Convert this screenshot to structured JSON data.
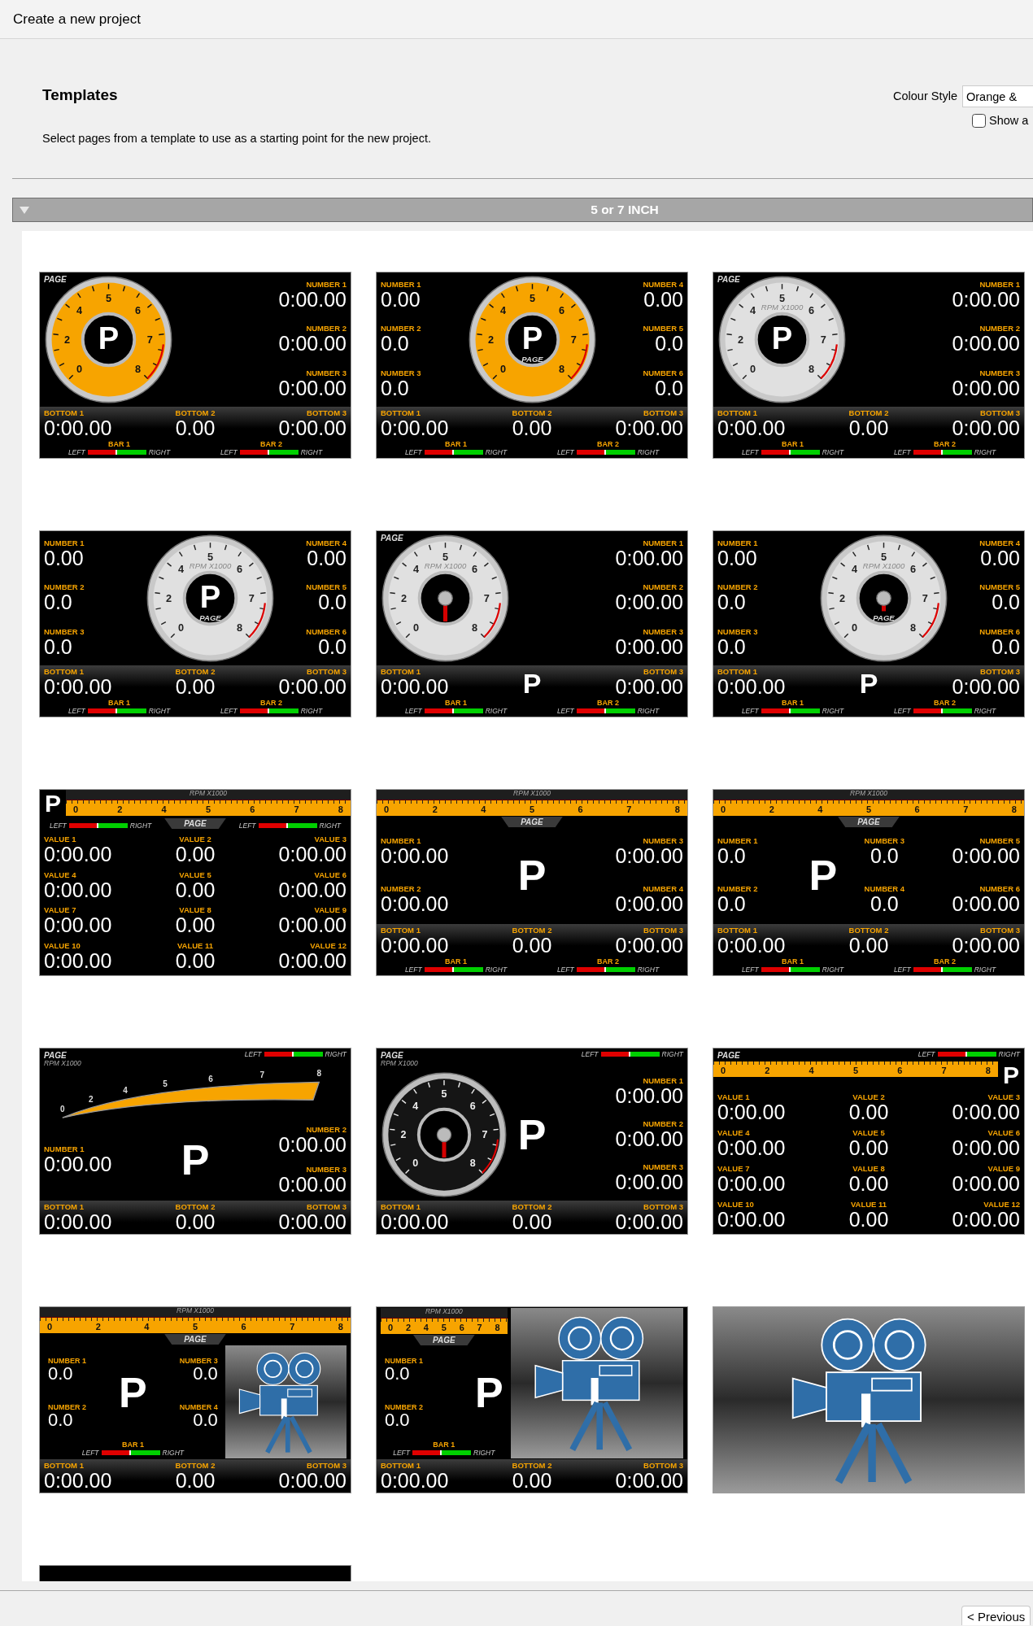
{
  "window": {
    "title": "Create a new project"
  },
  "header": {
    "title": "Templates",
    "description": "Select pages from a template to use as a starting point for the new project."
  },
  "colour_style": {
    "label": "Colour Style",
    "value": "Orange &"
  },
  "show_option": {
    "label": "Show a",
    "checked": false
  },
  "group": {
    "title": "5 or 7 INCH",
    "expanded": true,
    "templates": [
      {
        "kind": "preview",
        "sections": [
          {
            "kind": "main",
            "page": "PAGE",
            "columns": [
              [
                {
                  "kind": "dial",
                  "ticks": [
                    "0",
                    "2",
                    "4",
                    "5",
                    "6",
                    "7",
                    "8"
                  ],
                  "gear": "P",
                  "needle": false
                }
              ],
              [
                {
                  "kind": "number",
                  "label": "NUMBER 1",
                  "value": "0:00.00"
                },
                {
                  "kind": "number",
                  "label": "NUMBER 2",
                  "value": "0:00.00"
                },
                {
                  "kind": "number",
                  "label": "NUMBER 3",
                  "value": "0:00.00"
                }
              ]
            ]
          },
          {
            "kind": "bottom",
            "items": [
              {
                "kind": "number",
                "label": "BOTTOM 1",
                "value": "0:00.00"
              },
              {
                "kind": "number",
                "label": "BOTTOM 2",
                "value": "0.00"
              },
              {
                "kind": "number",
                "label": "BOTTOM 3",
                "value": "0:00.00"
              }
            ]
          },
          {
            "kind": "bars",
            "bars": [
              {
                "label": "BAR 1",
                "left": "LEFT",
                "right": "RIGHT",
                "level": 0.5
              },
              {
                "label": "BAR 2",
                "left": "LEFT",
                "right": "RIGHT",
                "level": 0.5
              }
            ]
          }
        ]
      },
      {
        "kind": "preview",
        "sections": [
          {
            "kind": "main",
            "columns": [
              [
                {
                  "kind": "number",
                  "label": "NUMBER 1",
                  "value": "0.00"
                },
                {
                  "kind": "number",
                  "label": "NUMBER 2",
                  "value": "0.0"
                },
                {
                  "kind": "number",
                  "label": "NUMBER 3",
                  "value": "0.0"
                }
              ],
              [
                {
                  "kind": "dial",
                  "ticks": [
                    "0",
                    "2",
                    "4",
                    "5",
                    "6",
                    "7",
                    "8"
                  ],
                  "gear": "P",
                  "page": "PAGE",
                  "needle": false
                }
              ],
              [
                {
                  "kind": "number",
                  "label": "NUMBER 4",
                  "value": "0.00"
                },
                {
                  "kind": "number",
                  "label": "NUMBER 5",
                  "value": "0.0"
                },
                {
                  "kind": "number",
                  "label": "NUMBER 6",
                  "value": "0.0"
                }
              ]
            ]
          },
          {
            "kind": "bottom",
            "items": [
              {
                "kind": "number",
                "label": "BOTTOM 1",
                "value": "0:00.00"
              },
              {
                "kind": "number",
                "label": "BOTTOM 2",
                "value": "0.00"
              },
              {
                "kind": "number",
                "label": "BOTTOM 3",
                "value": "0:00.00"
              }
            ]
          },
          {
            "kind": "bars",
            "bars": [
              {
                "label": "BAR 1",
                "left": "LEFT",
                "right": "RIGHT",
                "level": 0.5
              },
              {
                "label": "BAR 2",
                "left": "LEFT",
                "right": "RIGHT",
                "level": 0.5
              }
            ]
          }
        ]
      },
      {
        "kind": "preview",
        "sections": [
          {
            "kind": "main",
            "page": "PAGE",
            "columns": [
              [
                {
                  "kind": "silverdial",
                  "ticks": [
                    "0",
                    "2",
                    "4",
                    "5",
                    "6",
                    "7",
                    "8"
                  ],
                  "scale": "RPM X1000",
                  "gear": "P",
                  "needle": false
                }
              ],
              [
                {
                  "kind": "number",
                  "label": "NUMBER 1",
                  "value": "0:00.00"
                },
                {
                  "kind": "number",
                  "label": "NUMBER 2",
                  "value": "0:00.00"
                },
                {
                  "kind": "number",
                  "label": "NUMBER 3",
                  "value": "0:00.00"
                }
              ]
            ]
          },
          {
            "kind": "bottom",
            "items": [
              {
                "kind": "number",
                "label": "BOTTOM 1",
                "value": "0:00.00"
              },
              {
                "kind": "number",
                "label": "BOTTOM 2",
                "value": "0.00"
              },
              {
                "kind": "number",
                "label": "BOTTOM 3",
                "value": "0:00.00"
              }
            ]
          },
          {
            "kind": "bars",
            "bars": [
              {
                "label": "BAR 1",
                "left": "LEFT",
                "right": "RIGHT",
                "level": 0.5
              },
              {
                "label": "BAR 2",
                "left": "LEFT",
                "right": "RIGHT",
                "level": 0.5
              }
            ]
          }
        ]
      },
      {
        "kind": "preview",
        "sections": [
          {
            "kind": "main",
            "columns": [
              [
                {
                  "kind": "number",
                  "label": "NUMBER 1",
                  "value": "0.00"
                },
                {
                  "kind": "number",
                  "label": "NUMBER 2",
                  "value": "0.0"
                },
                {
                  "kind": "number",
                  "label": "NUMBER 3",
                  "value": "0.0"
                }
              ],
              [
                {
                  "kind": "silverdial",
                  "ticks": [
                    "0",
                    "2",
                    "4",
                    "5",
                    "6",
                    "7",
                    "8"
                  ],
                  "scale": "RPM X1000",
                  "gear": "P",
                  "page": "PAGE",
                  "needle": false
                }
              ],
              [
                {
                  "kind": "number",
                  "label": "NUMBER 4",
                  "value": "0.00"
                },
                {
                  "kind": "number",
                  "label": "NUMBER 5",
                  "value": "0.0"
                },
                {
                  "kind": "number",
                  "label": "NUMBER 6",
                  "value": "0.0"
                }
              ]
            ]
          },
          {
            "kind": "bottom",
            "items": [
              {
                "kind": "number",
                "label": "BOTTOM 1",
                "value": "0:00.00"
              },
              {
                "kind": "number",
                "label": "BOTTOM 2",
                "value": "0.00"
              },
              {
                "kind": "number",
                "label": "BOTTOM 3",
                "value": "0:00.00"
              }
            ]
          },
          {
            "kind": "bars",
            "bars": [
              {
                "label": "BAR 1",
                "left": "LEFT",
                "right": "RIGHT",
                "level": 0.5
              },
              {
                "label": "BAR 2",
                "left": "LEFT",
                "right": "RIGHT",
                "level": 0.5
              }
            ]
          }
        ]
      },
      {
        "kind": "preview",
        "sections": [
          {
            "kind": "main",
            "page": "PAGE",
            "columns": [
              [
                {
                  "kind": "silverdial",
                  "ticks": [
                    "0",
                    "2",
                    "4",
                    "5",
                    "6",
                    "7",
                    "8"
                  ],
                  "scale": "RPM X1000",
                  "needle": true
                }
              ],
              [
                {
                  "kind": "number",
                  "label": "NUMBER 1",
                  "value": "0:00.00"
                },
                {
                  "kind": "number",
                  "label": "NUMBER 2",
                  "value": "0:00.00"
                },
                {
                  "kind": "number",
                  "label": "NUMBER 3",
                  "value": "0:00.00"
                }
              ]
            ]
          },
          {
            "kind": "bottom",
            "items": [
              {
                "kind": "number",
                "label": "BOTTOM 1",
                "value": "0:00.00"
              },
              {
                "kind": "gear",
                "text": "P"
              },
              {
                "kind": "number",
                "label": "BOTTOM 3",
                "value": "0:00.00"
              }
            ]
          },
          {
            "kind": "bars",
            "bars": [
              {
                "label": "BAR 1",
                "left": "LEFT",
                "right": "RIGHT",
                "level": 0.5
              },
              {
                "label": "BAR 2",
                "left": "LEFT",
                "right": "RIGHT",
                "level": 0.5
              }
            ]
          }
        ]
      },
      {
        "kind": "preview",
        "sections": [
          {
            "kind": "main",
            "columns": [
              [
                {
                  "kind": "number",
                  "label": "NUMBER 1",
                  "value": "0.00"
                },
                {
                  "kind": "number",
                  "label": "NUMBER 2",
                  "value": "0.0"
                },
                {
                  "kind": "number",
                  "label": "NUMBER 3",
                  "value": "0.0"
                }
              ],
              [
                {
                  "kind": "silverdial",
                  "ticks": [
                    "0",
                    "2",
                    "4",
                    "5",
                    "6",
                    "7",
                    "8"
                  ],
                  "scale": "RPM X1000",
                  "page": "PAGE",
                  "needle": true
                }
              ],
              [
                {
                  "kind": "number",
                  "label": "NUMBER 4",
                  "value": "0.00"
                },
                {
                  "kind": "number",
                  "label": "NUMBER 5",
                  "value": "0.0"
                },
                {
                  "kind": "number",
                  "label": "NUMBER 6",
                  "value": "0.0"
                }
              ]
            ]
          },
          {
            "kind": "bottom",
            "items": [
              {
                "kind": "number",
                "label": "BOTTOM 1",
                "value": "0:00.00"
              },
              {
                "kind": "gear",
                "text": "P"
              },
              {
                "kind": "number",
                "label": "BOTTOM 3",
                "value": "0:00.00"
              }
            ]
          },
          {
            "kind": "bars",
            "bars": [
              {
                "label": "BAR 1",
                "left": "LEFT",
                "right": "RIGHT",
                "level": 0.5
              },
              {
                "label": "BAR 2",
                "left": "LEFT",
                "right": "RIGHT",
                "level": 0.5
              }
            ]
          }
        ]
      },
      {
        "kind": "preview",
        "sections": [
          {
            "kind": "ruler",
            "scale": "RPM X1000",
            "ticks": [
              "0",
              "2",
              "4",
              "5",
              "6",
              "7",
              "8"
            ],
            "gear": "P"
          },
          {
            "kind": "bars",
            "page": "PAGE",
            "bars": [
              {
                "left": "LEFT",
                "right": "RIGHT",
                "level": 0.5
              },
              {
                "left": "LEFT",
                "right": "RIGHT",
                "level": 0.5
              }
            ]
          },
          {
            "kind": "main",
            "columns": [
              [
                {
                  "kind": "number",
                  "label": "VALUE 1",
                  "value": "0:00.00"
                },
                {
                  "kind": "number",
                  "label": "VALUE 4",
                  "value": "0:00.00"
                },
                {
                  "kind": "number",
                  "label": "VALUE 7",
                  "value": "0:00.00"
                },
                {
                  "kind": "number",
                  "label": "VALUE 10",
                  "value": "0:00.00"
                }
              ],
              [
                {
                  "kind": "number",
                  "label": "VALUE 2",
                  "value": "0.00"
                },
                {
                  "kind": "number",
                  "label": "VALUE 5",
                  "value": "0.00"
                },
                {
                  "kind": "number",
                  "label": "VALUE 8",
                  "value": "0.00"
                },
                {
                  "kind": "number",
                  "label": "VALUE 11",
                  "value": "0.00"
                }
              ],
              [
                {
                  "kind": "number",
                  "label": "VALUE 3",
                  "value": "0:00.00"
                },
                {
                  "kind": "number",
                  "label": "VALUE 6",
                  "value": "0:00.00"
                },
                {
                  "kind": "number",
                  "label": "VALUE 9",
                  "value": "0:00.00"
                },
                {
                  "kind": "number",
                  "label": "VALUE 12",
                  "value": "0:00.00"
                }
              ]
            ]
          }
        ]
      },
      {
        "kind": "preview",
        "sections": [
          {
            "kind": "ruler",
            "scale": "RPM X1000",
            "ticks": [
              "0",
              "2",
              "4",
              "5",
              "6",
              "7",
              "8"
            ]
          },
          {
            "kind": "tab",
            "page": "PAGE"
          },
          {
            "kind": "main",
            "columns": [
              [
                {
                  "kind": "number",
                  "label": "NUMBER 1",
                  "value": "0:00.00"
                },
                {
                  "kind": "number",
                  "label": "NUMBER 2",
                  "value": "0:00.00"
                }
              ],
              [
                {
                  "kind": "gear",
                  "text": "P"
                }
              ],
              [
                {
                  "kind": "number",
                  "label": "NUMBER 3",
                  "value": "0:00.00"
                },
                {
                  "kind": "number",
                  "label": "NUMBER 4",
                  "value": "0:00.00"
                }
              ]
            ]
          },
          {
            "kind": "bottom",
            "items": [
              {
                "kind": "number",
                "label": "BOTTOM 1",
                "value": "0:00.00"
              },
              {
                "kind": "number",
                "label": "BOTTOM 2",
                "value": "0.00"
              },
              {
                "kind": "number",
                "label": "BOTTOM 3",
                "value": "0:00.00"
              }
            ]
          },
          {
            "kind": "bars",
            "bars": [
              {
                "label": "BAR 1",
                "left": "LEFT",
                "right": "RIGHT",
                "level": 0.5
              },
              {
                "label": "BAR 2",
                "left": "LEFT",
                "right": "RIGHT",
                "level": 0.5
              }
            ]
          }
        ]
      },
      {
        "kind": "preview",
        "sections": [
          {
            "kind": "ruler",
            "scale": "RPM X1000",
            "ticks": [
              "0",
              "2",
              "4",
              "5",
              "6",
              "7",
              "8"
            ]
          },
          {
            "kind": "tab",
            "page": "PAGE"
          },
          {
            "kind": "main",
            "columns": [
              [
                {
                  "kind": "number",
                  "label": "NUMBER 1",
                  "value": "0.0"
                },
                {
                  "kind": "number",
                  "label": "NUMBER 2",
                  "value": "0.0"
                }
              ],
              [
                {
                  "kind": "gear",
                  "text": "P"
                }
              ],
              [
                {
                  "kind": "number",
                  "label": "NUMBER 3",
                  "value": "0.0"
                },
                {
                  "kind": "number",
                  "label": "NUMBER 4",
                  "value": "0.0"
                }
              ],
              [
                {
                  "kind": "number",
                  "label": "NUMBER 5",
                  "value": "0:00.00"
                },
                {
                  "kind": "number",
                  "label": "NUMBER 6",
                  "value": "0:00.00"
                }
              ]
            ]
          },
          {
            "kind": "bottom",
            "items": [
              {
                "kind": "number",
                "label": "BOTTOM 1",
                "value": "0:00.00"
              },
              {
                "kind": "number",
                "label": "BOTTOM 2",
                "value": "0.00"
              },
              {
                "kind": "number",
                "label": "BOTTOM 3",
                "value": "0:00.00"
              }
            ]
          },
          {
            "kind": "bars",
            "bars": [
              {
                "label": "BAR 1",
                "left": "LEFT",
                "right": "RIGHT",
                "level": 0.5
              },
              {
                "label": "BAR 2",
                "left": "LEFT",
                "right": "RIGHT",
                "level": 0.5
              }
            ]
          }
        ]
      },
      {
        "kind": "preview",
        "sections": [
          {
            "kind": "header",
            "page": "PAGE",
            "scale": "RPM X1000",
            "bars": [
              {
                "left": "LEFT",
                "right": "RIGHT",
                "level": 0.5
              }
            ]
          },
          {
            "kind": "arc",
            "ticks": [
              "0",
              "2",
              "4",
              "5",
              "6",
              "7",
              "8"
            ]
          },
          {
            "kind": "main",
            "columns": [
              [
                {
                  "kind": "number",
                  "label": "NUMBER 1",
                  "value": "0:00.00"
                }
              ],
              [
                {
                  "kind": "gear",
                  "text": "P"
                }
              ],
              [
                {
                  "kind": "number",
                  "label": "NUMBER 2",
                  "value": "0:00.00"
                },
                {
                  "kind": "number",
                  "label": "NUMBER 3",
                  "value": "0:00.00"
                }
              ]
            ]
          },
          {
            "kind": "bottom",
            "items": [
              {
                "kind": "number",
                "label": "BOTTOM 1",
                "value": "0:00.00"
              },
              {
                "kind": "number",
                "label": "BOTTOM 2",
                "value": "0.00"
              },
              {
                "kind": "number",
                "label": "BOTTOM 3",
                "value": "0:00.00"
              }
            ]
          }
        ]
      },
      {
        "kind": "preview",
        "sections": [
          {
            "kind": "header",
            "page": "PAGE",
            "scale": "RPM X1000",
            "bars": [
              {
                "left": "LEFT",
                "right": "RIGHT",
                "level": 0.5
              }
            ]
          },
          {
            "kind": "main",
            "columns": [
              [
                {
                  "kind": "darkdial",
                  "ticks": [
                    "0",
                    "2",
                    "4",
                    "5",
                    "6",
                    "7",
                    "8"
                  ],
                  "needle": true
                }
              ],
              [
                {
                  "kind": "gear",
                  "text": "P"
                }
              ],
              [
                {
                  "kind": "number",
                  "label": "NUMBER 1",
                  "value": "0:00.00"
                },
                {
                  "kind": "number",
                  "label": "NUMBER 2",
                  "value": "0:00.00"
                },
                {
                  "kind": "number",
                  "label": "NUMBER 3",
                  "value": "0:00.00"
                }
              ]
            ]
          },
          {
            "kind": "bottom",
            "items": [
              {
                "kind": "number",
                "label": "BOTTOM 1",
                "value": "0:00.00"
              },
              {
                "kind": "number",
                "label": "BOTTOM 2",
                "value": "0.00"
              },
              {
                "kind": "number",
                "label": "BOTTOM 3",
                "value": "0:00.00"
              }
            ]
          }
        ]
      },
      {
        "kind": "preview",
        "sections": [
          {
            "kind": "header",
            "page": "PAGE",
            "bars": [
              {
                "left": "LEFT",
                "right": "RIGHT",
                "level": 0.5
              }
            ]
          },
          {
            "kind": "scalebar",
            "ticks": [
              "0",
              "2",
              "4",
              "5",
              "6",
              "7",
              "8"
            ],
            "gear": "P"
          },
          {
            "kind": "main",
            "columns": [
              [
                {
                  "kind": "number",
                  "label": "VALUE 1",
                  "value": "0:00.00"
                },
                {
                  "kind": "number",
                  "label": "VALUE 4",
                  "value": "0:00.00"
                },
                {
                  "kind": "number",
                  "label": "VALUE 7",
                  "value": "0:00.00"
                },
                {
                  "kind": "number",
                  "label": "VALUE 10",
                  "value": "0:00.00"
                }
              ],
              [
                {
                  "kind": "number",
                  "label": "VALUE 2",
                  "value": "0.00"
                },
                {
                  "kind": "number",
                  "label": "VALUE 5",
                  "value": "0.00"
                },
                {
                  "kind": "number",
                  "label": "VALUE 8",
                  "value": "0.00"
                },
                {
                  "kind": "number",
                  "label": "VALUE 11",
                  "value": "0.00"
                }
              ],
              [
                {
                  "kind": "number",
                  "label": "VALUE 3",
                  "value": "0:00.00"
                },
                {
                  "kind": "number",
                  "label": "VALUE 6",
                  "value": "0:00.00"
                },
                {
                  "kind": "number",
                  "label": "VALUE 9",
                  "value": "0:00.00"
                },
                {
                  "kind": "number",
                  "label": "VALUE 12",
                  "value": "0:00.00"
                }
              ]
            ]
          }
        ]
      },
      {
        "kind": "preview",
        "sections": [
          {
            "kind": "ruler",
            "scale": "RPM X1000",
            "ticks": [
              "0",
              "2",
              "4",
              "5",
              "6",
              "7",
              "8"
            ]
          },
          {
            "kind": "tab",
            "page": "PAGE"
          },
          {
            "kind": "main",
            "columns": [
              [
                {
                  "kind": "panel",
                  "sections": [
                    {
                      "kind": "main",
                      "columns": [
                        [
                          {
                            "kind": "number",
                            "label": "NUMBER 1",
                            "value": "0.0"
                          },
                          {
                            "kind": "number",
                            "label": "NUMBER 2",
                            "value": "0.0"
                          }
                        ],
                        [
                          {
                            "kind": "gear",
                            "text": "P"
                          }
                        ],
                        [
                          {
                            "kind": "number",
                            "label": "NUMBER 3",
                            "value": "0.0"
                          },
                          {
                            "kind": "number",
                            "label": "NUMBER 4",
                            "value": "0.0"
                          }
                        ]
                      ]
                    },
                    {
                      "kind": "bars",
                      "bars": [
                        {
                          "label": "BAR 1",
                          "left": "LEFT",
                          "right": "RIGHT",
                          "level": 0.5
                        }
                      ]
                    }
                  ]
                }
              ],
              [
                {
                  "kind": "camera"
                }
              ]
            ]
          },
          {
            "kind": "bottom",
            "items": [
              {
                "kind": "number",
                "label": "BOTTOM 1",
                "value": "0:00.00"
              },
              {
                "kind": "number",
                "label": "BOTTOM 2",
                "value": "0.00"
              },
              {
                "kind": "number",
                "label": "BOTTOM 3",
                "value": "0:00.00"
              }
            ]
          }
        ]
      },
      {
        "kind": "preview",
        "sections": [
          {
            "kind": "main",
            "columns": [
              [
                {
                  "kind": "panel",
                  "sections": [
                    {
                      "kind": "ruler",
                      "scale": "RPM X1000",
                      "ticks": [
                        "0",
                        "2",
                        "4",
                        "5",
                        "6",
                        "7",
                        "8"
                      ]
                    },
                    {
                      "kind": "tab",
                      "page": "PAGE"
                    },
                    {
                      "kind": "main",
                      "columns": [
                        [
                          {
                            "kind": "number",
                            "label": "NUMBER 1",
                            "value": "0.0"
                          },
                          {
                            "kind": "number",
                            "label": "NUMBER 2",
                            "value": "0.0"
                          }
                        ],
                        [
                          {
                            "kind": "gear",
                            "text": "P"
                          }
                        ]
                      ]
                    },
                    {
                      "kind": "bars",
                      "bars": [
                        {
                          "label": "BAR 1",
                          "left": "LEFT",
                          "right": "RIGHT",
                          "level": 0.5
                        }
                      ]
                    }
                  ]
                }
              ],
              [
                {
                  "kind": "camera"
                }
              ]
            ]
          },
          {
            "kind": "bottom",
            "items": [
              {
                "kind": "number",
                "label": "BOTTOM 1",
                "value": "0:00.00"
              },
              {
                "kind": "number",
                "label": "BOTTOM 2",
                "value": "0.00"
              },
              {
                "kind": "number",
                "label": "BOTTOM 3",
                "value": "0:00.00"
              }
            ]
          }
        ]
      },
      {
        "kind": "preview",
        "sections": [
          {
            "kind": "camera"
          }
        ]
      },
      {
        "kind": "partial"
      }
    ]
  },
  "buttons": [
    {
      "label": "< Previous"
    }
  ]
}
